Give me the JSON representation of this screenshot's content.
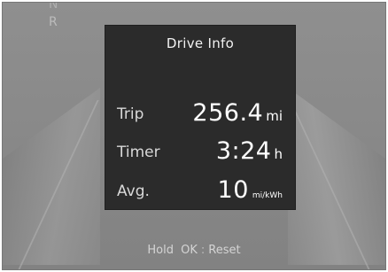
{
  "gear": {
    "top_mark": "N",
    "r_mark": "R"
  },
  "drive_info": {
    "title": "Drive Info",
    "rows": [
      {
        "label": "Trip",
        "value": "256.4",
        "unit": "mi"
      },
      {
        "label": "Timer",
        "value": "3:24",
        "unit": "h"
      },
      {
        "label": "Avg.",
        "value": "10",
        "unit": "mi/kWh"
      }
    ]
  },
  "hint": {
    "hold": "Hold",
    "button": "OK",
    "separator": ":",
    "action": "Reset"
  },
  "colors": {
    "panel": "#2b2b2b",
    "background": "#8a8a8a",
    "text": "#ffffff"
  }
}
